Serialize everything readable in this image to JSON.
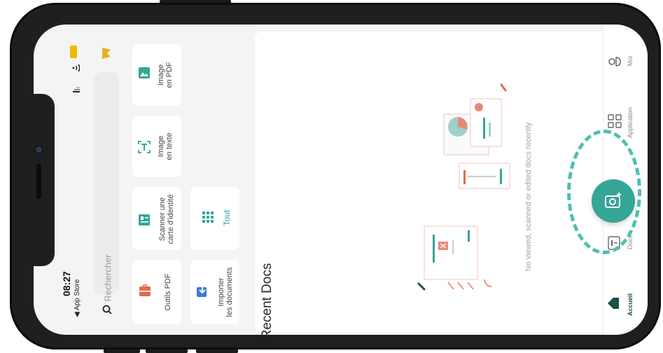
{
  "status_bar": {
    "time": "08:27",
    "back_label": "◀ App Store"
  },
  "search": {
    "placeholder": "Rechercher"
  },
  "tools": [
    {
      "id": "image-pdf",
      "label": "Image\nen PDF"
    },
    {
      "id": "image-text",
      "label": "Image\nen texte"
    },
    {
      "id": "scan-id",
      "label": "Scanner une\ncarte d'identité"
    },
    {
      "id": "pdf-tools",
      "label": "Outils PDF"
    },
    {
      "id": "all",
      "label": "Tout"
    },
    {
      "id": "import",
      "label": "Importer\nles documents"
    }
  ],
  "main": {
    "recent_title": "Recent Docs",
    "empty_text": "No viewed, scanned or edited docs recently"
  },
  "tabs": [
    {
      "id": "accueil",
      "label": "Accueil",
      "icon": "home-icon",
      "active": true
    },
    {
      "id": "docs",
      "label": "Docs",
      "icon": "docs-icon",
      "active": false
    },
    {
      "id": "application",
      "label": "Application",
      "icon": "apps-icon",
      "active": false
    },
    {
      "id": "moi",
      "label": "Moi",
      "icon": "profile-icon",
      "active": false
    }
  ],
  "fab": {
    "icon": "camera-plus-icon"
  },
  "colors": {
    "accent": "#35a596",
    "highlight": "#4fbfae",
    "background": "#f4f4f4"
  }
}
